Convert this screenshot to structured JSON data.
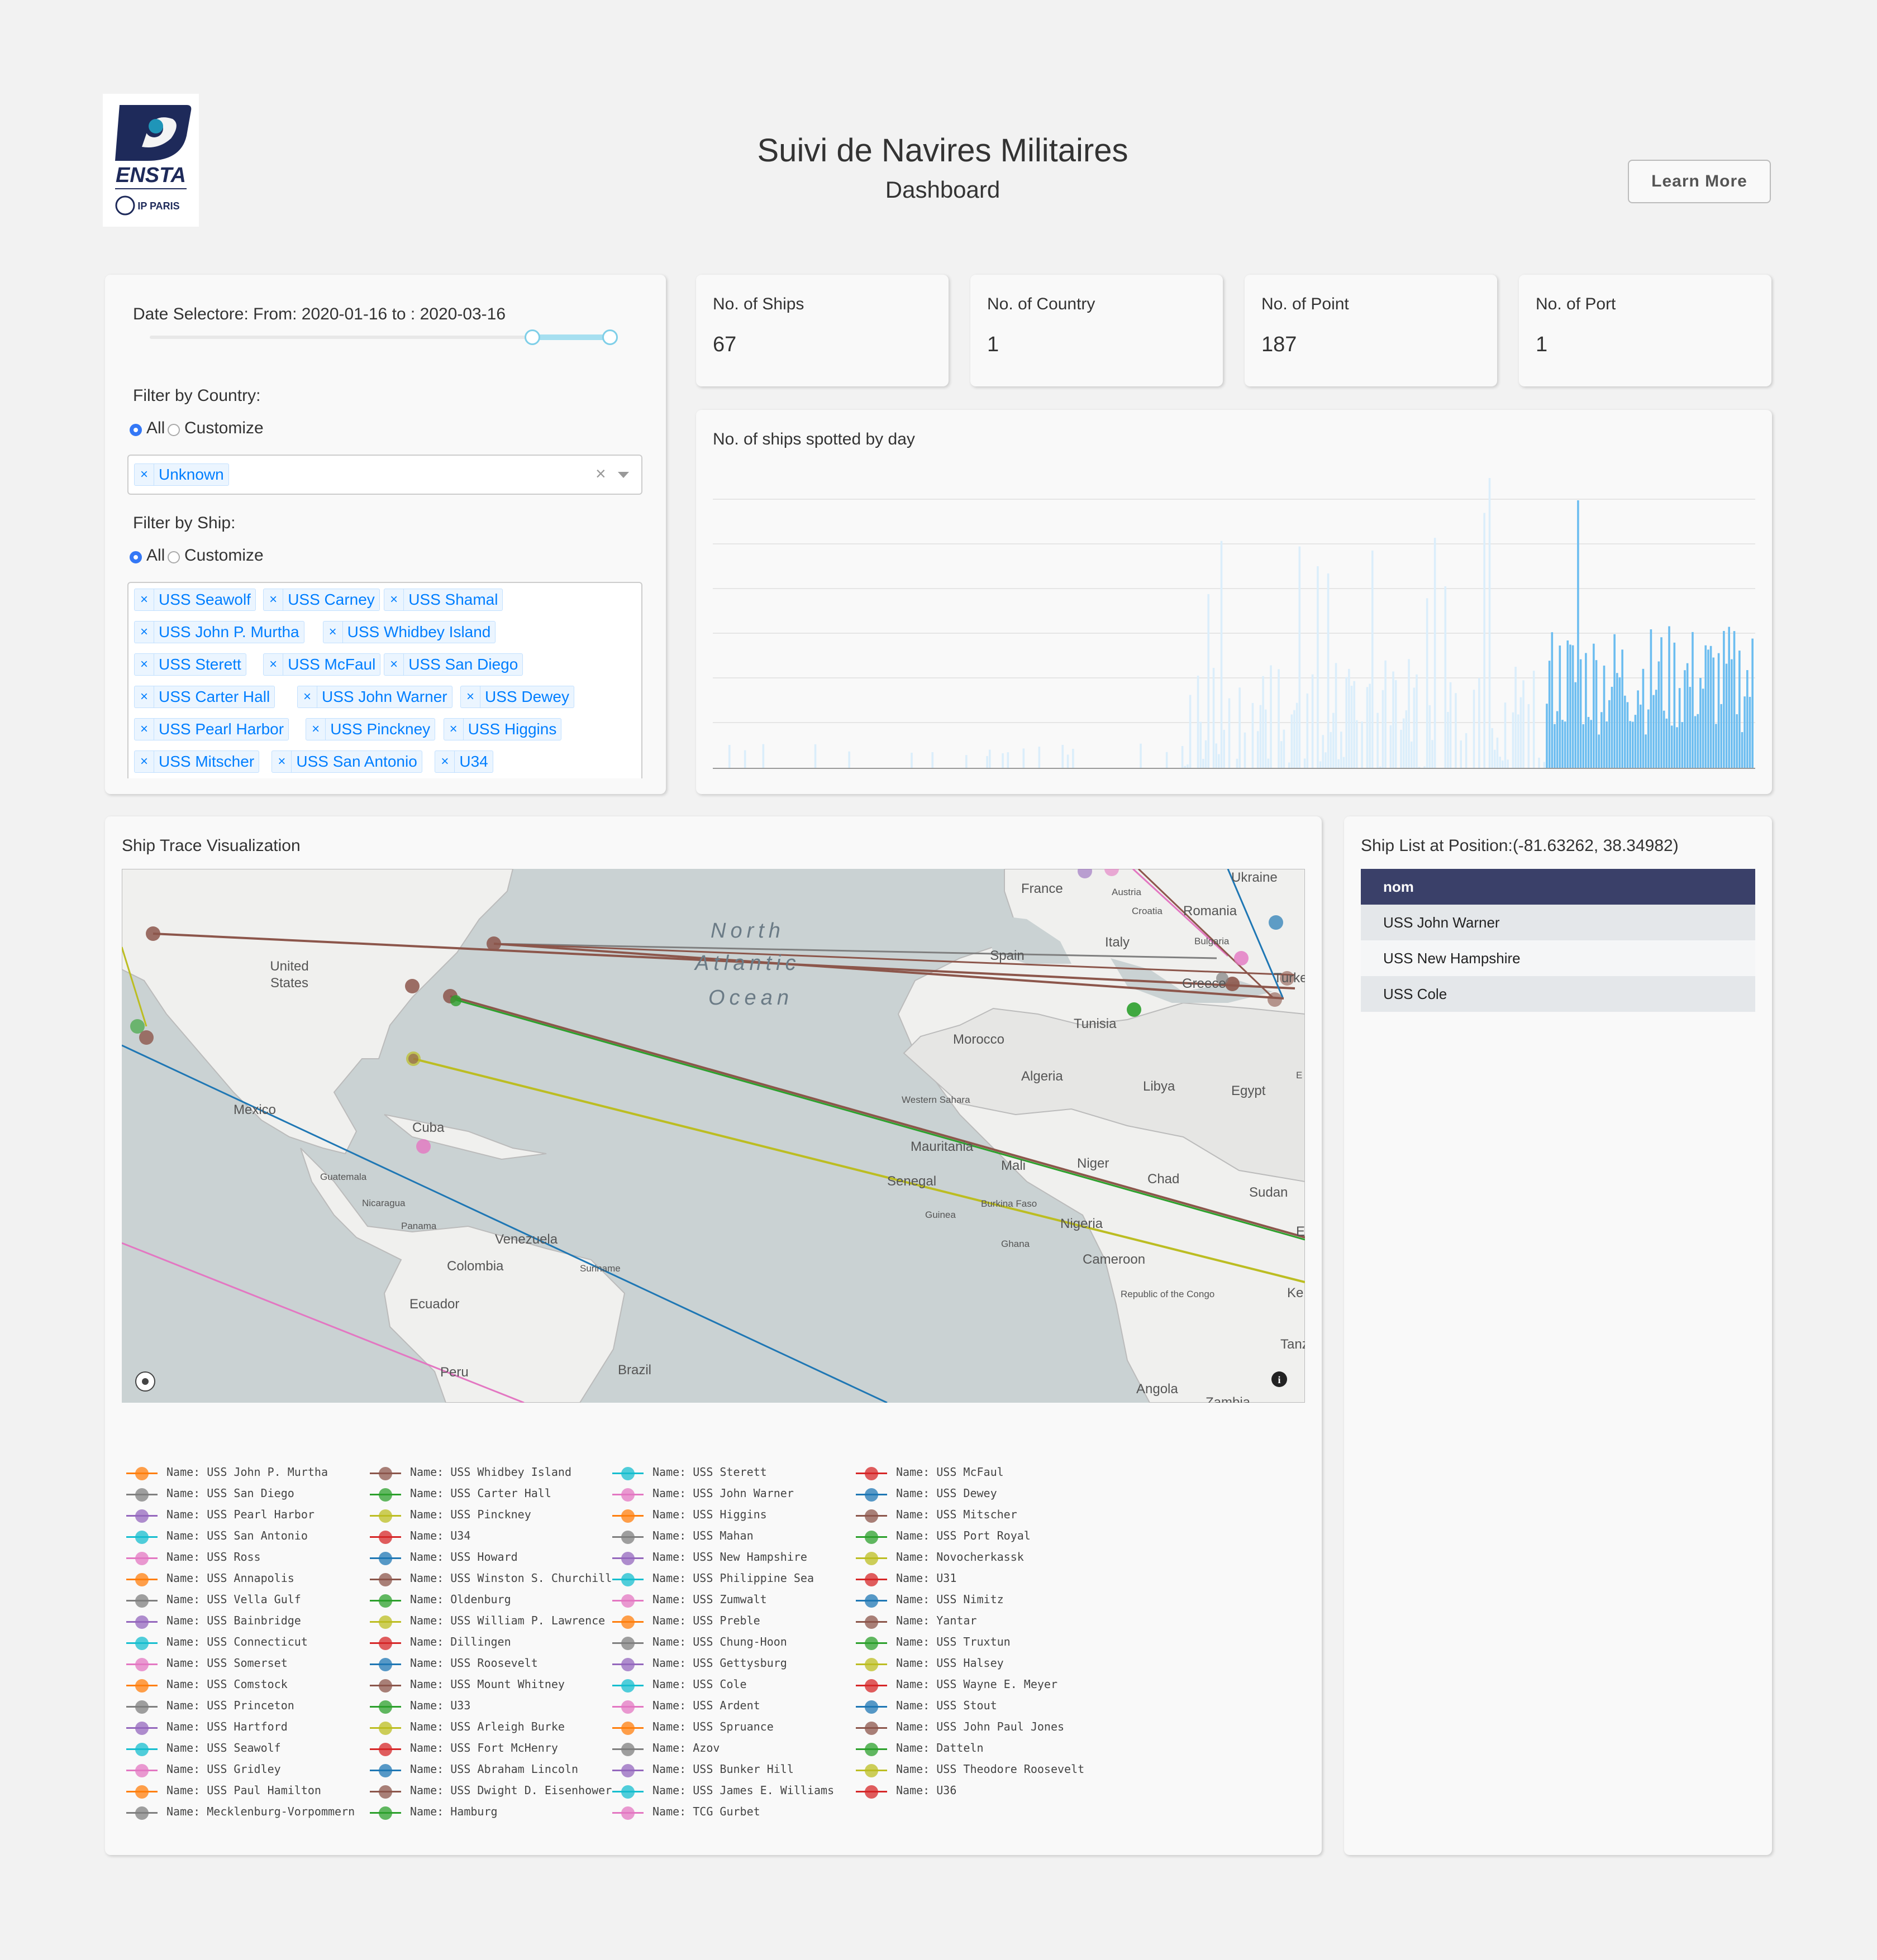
{
  "header": {
    "logo_text": "ENSTA",
    "logo_sub": "IP PARIS",
    "title": "Suivi de Navires Militaires",
    "subtitle": "Dashboard",
    "learn_more": "Learn More"
  },
  "filters": {
    "date_label": "Date Selectore: From: 2020-01-16 to : 2020-03-16",
    "country_label": "Filter by Country:",
    "ship_label": "Filter by Ship:",
    "radio_all": "All",
    "radio_customize": "Customize",
    "country_tags": [
      "Unknown"
    ],
    "clear_symbol": "×",
    "ship_tags": [
      "USS Seawolf",
      "USS Carney",
      "USS Shamal",
      "USS John P. Murtha",
      "USS Whidbey Island",
      "USS Sterett",
      "USS McFaul",
      "USS San Diego",
      "USS Carter Hall",
      "USS John Warner",
      "USS Dewey",
      "USS Pearl Harbor",
      "USS Pinckney",
      "USS Higgins",
      "USS Mitscher",
      "USS San Antonio",
      "U34"
    ]
  },
  "stats": [
    {
      "title": "No. of Ships",
      "value": "67"
    },
    {
      "title": "No. of Country",
      "value": "1"
    },
    {
      "title": "No. of Point",
      "value": "187"
    },
    {
      "title": "No. of Port",
      "value": "1"
    }
  ],
  "histogram": {
    "title": "No. of ships spotted by day"
  },
  "map": {
    "title": "Ship Trace Visualization",
    "ocean_line1": "North",
    "ocean_line2": "Atlantic",
    "ocean_line3": "Ocean",
    "labels": [
      "United States",
      "Mexico",
      "Cuba",
      "Guatemala",
      "Nicaragua",
      "Panama",
      "Venezuela",
      "Colombia",
      "Suriname",
      "Ecuador",
      "Peru",
      "Brazil",
      "France",
      "Austria",
      "Croatia",
      "Romania",
      "Bulgaria",
      "Ukraine",
      "Italy",
      "Spain",
      "Greece",
      "Turke",
      "Tunisia",
      "Morocco",
      "Algeria",
      "Libya",
      "Egypt",
      "Western Sahara",
      "Mauritania",
      "Mali",
      "Niger",
      "Chad",
      "Sudan",
      "Senegal",
      "Guinea",
      "Burkina Faso",
      "Nigeria",
      "Ghana",
      "Cameroon",
      "Republic of the Congo",
      "Ke",
      "Tanzan",
      "Angola",
      "Zambia",
      "E",
      "E"
    ]
  },
  "ship_list": {
    "title": "Ship List at Position:(-81.63262, 38.34982)",
    "header": "nom",
    "rows": [
      "USS John Warner",
      "USS New Hampshire",
      "USS Cole"
    ],
    "header_color": "#3a4069"
  },
  "legend": {
    "columns": [
      [
        "Name: USS John P. Murtha",
        "Name: USS San Diego",
        "Name: USS Pearl Harbor",
        "Name: USS San Antonio",
        "Name: USS Ross",
        "Name: USS Annapolis",
        "Name: USS Vella Gulf",
        "Name: USS Bainbridge",
        "Name: USS Connecticut",
        "Name: USS Somerset",
        "Name: USS Comstock",
        "Name: USS Princeton",
        "Name: USS Hartford",
        "Name: USS Seawolf",
        "Name: USS Gridley",
        "Name: USS Paul Hamilton",
        "Name: Mecklenburg-Vorpommern"
      ],
      [
        "Name: USS Whidbey Island",
        "Name: USS Carter Hall",
        "Name: USS Pinckney",
        "Name: U34",
        "Name: USS Howard",
        "Name: USS Winston S. Churchill",
        "Name: Oldenburg",
        "Name: USS William P. Lawrence",
        "Name: Dillingen",
        "Name: USS Roosevelt",
        "Name: USS Mount Whitney",
        "Name: U33",
        "Name: USS Arleigh Burke",
        "Name: USS Fort McHenry",
        "Name: USS Abraham Lincoln",
        "Name: USS Dwight D. Eisenhower",
        "Name: Hamburg"
      ],
      [
        "Name: USS Sterett",
        "Name: USS John Warner",
        "Name: USS Higgins",
        "Name: USS Mahan",
        "Name: USS New Hampshire",
        "Name: USS Philippine Sea",
        "Name: USS Zumwalt",
        "Name: USS Preble",
        "Name: USS Chung-Hoon",
        "Name: USS Gettysburg",
        "Name: USS Cole",
        "Name: USS Ardent",
        "Name: USS Spruance",
        "Name: Azov",
        "Name: USS Bunker Hill",
        "Name: USS James E. Williams",
        "Name: TCG Gurbet"
      ],
      [
        "Name: USS McFaul",
        "Name: USS Dewey",
        "Name: USS Mitscher",
        "Name: USS Port Royal",
        "Name: Novocherkassk",
        "Name: U31",
        "Name: USS Nimitz",
        "Name: Yantar",
        "Name: USS Truxtun",
        "Name: USS Halsey",
        "Name: USS Wayne E. Meyer",
        "Name: USS Stout",
        "Name: USS John Paul Jones",
        "Name: Datteln",
        "Name: USS Theodore Roosevelt",
        "Name: U36"
      ]
    ],
    "colors": [
      "#ff7f0e",
      "#8c564b",
      "#17becf",
      "#d62728",
      "#7f7f7f",
      "#2ca02c",
      "#e377c2",
      "#1f77b4",
      "#9467bd",
      "#bcbd22"
    ]
  }
}
